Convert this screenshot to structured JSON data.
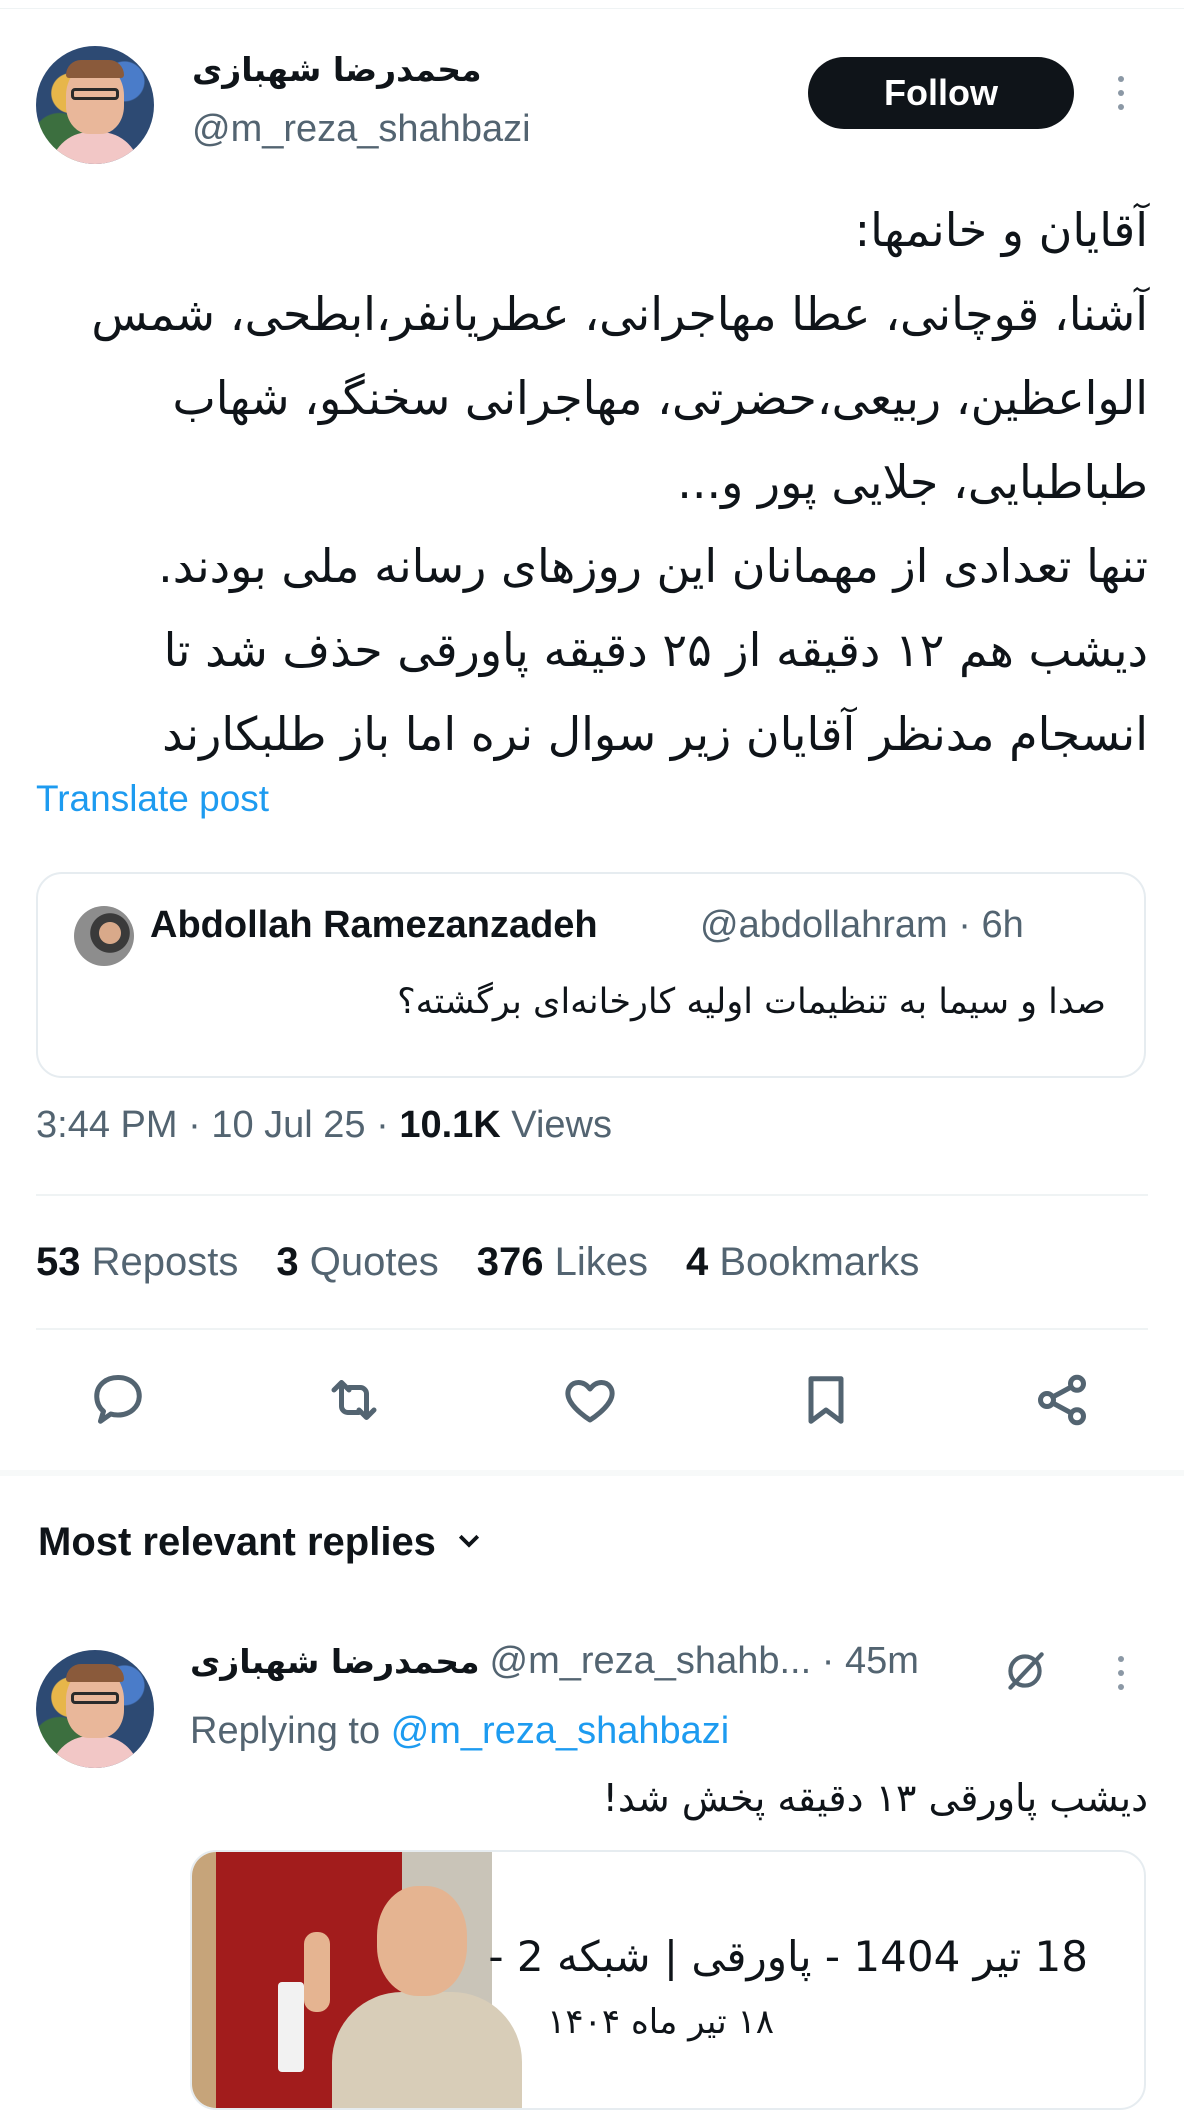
{
  "tweet": {
    "author_name": "محمدرضا شهبازی",
    "author_handle": "@m_reza_shahbazi",
    "follow_label": "Follow",
    "text": "آقایان و خانمها:\nآشنا، قوچانی، عطا مهاجرانی، عطریانفر،ابطحی، شمس الواعظین، ربیعی،حضرتی، مهاجرانی سخنگو، شهاب طباطبایی، جلایی پور و...\nتنها تعدادی از مهمانان این روزهای رسانه ملی بودند.\nدیشب هم ۱۲ دقیقه از ۲۵ دقیقه پاورقی حذف شد تا انسجام مدنظر آقایان زیر سوال نره اما باز طلبکارند",
    "translate_label": "Translate post",
    "time": "3:44 PM",
    "date": "10 Jul 25",
    "views_count": "10.1K",
    "views_label": "Views"
  },
  "quoted": {
    "name": "Abdollah Ramezanzadeh",
    "handle": "@abdollahram",
    "time": "6h",
    "text": "صدا و سیما به تنظیمات اولیه کارخانه‌ای برگشته؟"
  },
  "stats": [
    {
      "count": "53",
      "label": "Reposts"
    },
    {
      "count": "3",
      "label": "Quotes"
    },
    {
      "count": "376",
      "label": "Likes"
    },
    {
      "count": "4",
      "label": "Bookmarks"
    }
  ],
  "actions": [
    "reply-icon",
    "retweet-icon",
    "like-icon",
    "bookmark-icon",
    "share-icon"
  ],
  "replies": {
    "heading": "Most relevant replies",
    "reply": {
      "name": "محمدرضا شهبازی",
      "handle": "@m_reza_shahb...",
      "time": "45m",
      "replying_prefix": "Replying to",
      "replying_to": "@m_reza_shahbazi",
      "text": "دیشب پاورقی ۱۳ دقیقه پخش شد!",
      "card_title": "18 تیر 1404 - پاورقی | شبکه 2 -",
      "card_subtitle": "۱۸ تیر ماه ۱۴۰۴"
    }
  },
  "colors": {
    "accent": "#1d9bf0",
    "muted": "#536471",
    "text": "#0f1419"
  }
}
